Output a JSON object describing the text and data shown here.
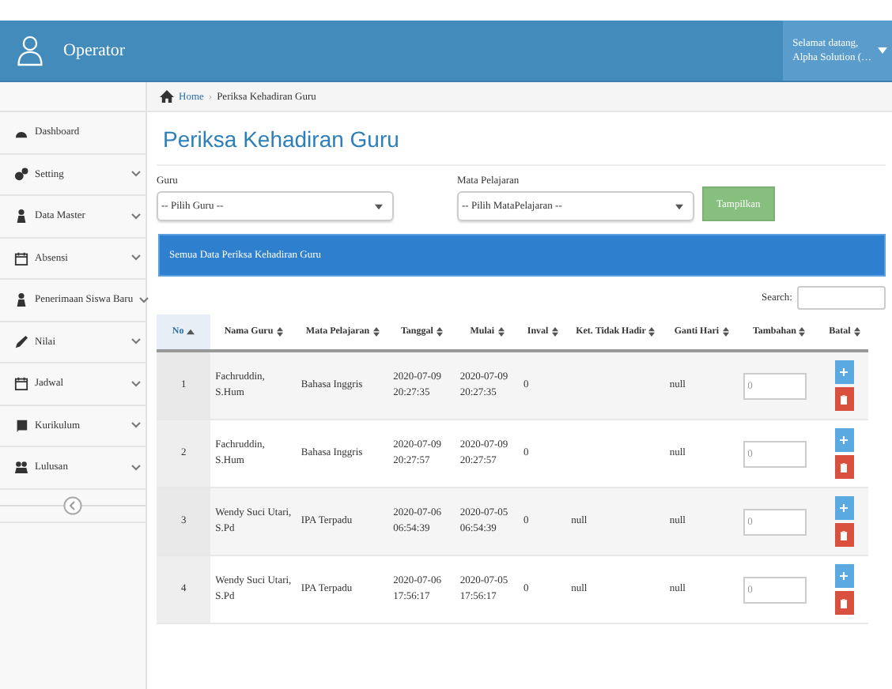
{
  "header": {
    "app_title": "Operator",
    "greeting": "Selamat datang,",
    "user_name": "Alpha Solution (…"
  },
  "breadcrumb": [
    {
      "kind": "link",
      "label": "Home"
    },
    {
      "kind": "separator",
      "label": "›"
    },
    {
      "kind": "current",
      "label": "Periksa Kehadiran Guru"
    }
  ],
  "sidebar": {
    "items": [
      {
        "label": "Dashboard",
        "expandable": false
      },
      {
        "label": "Setting",
        "expandable": true
      },
      {
        "label": "Data Master",
        "expandable": true
      },
      {
        "label": "Absensi",
        "expandable": true
      },
      {
        "label": "Penerimaan Siswa Baru",
        "expandable": true
      },
      {
        "label": "Nilai",
        "expandable": true
      },
      {
        "label": "Jadwal",
        "expandable": true
      },
      {
        "label": "Kurikulum",
        "expandable": true
      },
      {
        "label": "Lulusan",
        "expandable": true
      }
    ]
  },
  "page_title": "Periksa Kehadiran Guru",
  "filters": [
    {
      "label": "Guru",
      "value": "-- Pilih Guru --"
    },
    {
      "label": "Mata Pelajaran",
      "value": "-- Pilih MataPelajaran --"
    }
  ],
  "show_button": "Tampilkan",
  "panel_title": "Semua Data Periksa Kehadiran Guru",
  "search": {
    "label": "Search:"
  },
  "table": {
    "columns": [
      {
        "label": "No",
        "sorted": true
      },
      {
        "label": "Nama Guru",
        "sorted": false
      },
      {
        "label": "Mata Pelajaran",
        "sorted": false
      },
      {
        "label": "Tanggal",
        "sorted": false
      },
      {
        "label": "Mulai",
        "sorted": false
      },
      {
        "label": "Inval",
        "sorted": false
      },
      {
        "label": "Ket. Tidak Hadir",
        "sorted": false
      },
      {
        "label": "Ganti Hari",
        "sorted": false
      },
      {
        "label": "Tambahan",
        "sorted": false
      },
      {
        "label": "Batal",
        "sorted": false
      }
    ],
    "rows": [
      {
        "no": "1",
        "nama": "Fachruddin, S.Hum",
        "mapel": "Bahasa Inggris",
        "tanggal": "2020-07-09 20:27:35",
        "mulai": "2020-07-09 20:27:35",
        "inval": "0",
        "ganti_hari": "null",
        "tambahan": "0"
      },
      {
        "no": "2",
        "nama": "Fachruddin, S.Hum",
        "mapel": "Bahasa Inggris",
        "tanggal": "2020-07-09 20:27:57",
        "mulai": "2020-07-09 20:27:57",
        "inval": "0",
        "ganti_hari": "null",
        "tambahan": "0"
      },
      {
        "no": "3",
        "nama": "Wendy Suci Utari, S.Pd",
        "mapel": "IPA Terpadu",
        "tanggal": "2020-07-06 06:54:39",
        "mulai": "2020-07-05 06:54:39",
        "inval": "0",
        "ket": "null",
        "ganti_hari": "null",
        "tambahan": "0"
      },
      {
        "no": "4",
        "nama": "Wendy Suci Utari, S.Pd",
        "mapel": "IPA Terpadu",
        "tanggal": "2020-07-06 17:56:17",
        "mulai": "2020-07-05 17:56:17",
        "inval": "0",
        "ket": "null",
        "ganti_hari": "null",
        "tambahan": "0"
      }
    ]
  }
}
